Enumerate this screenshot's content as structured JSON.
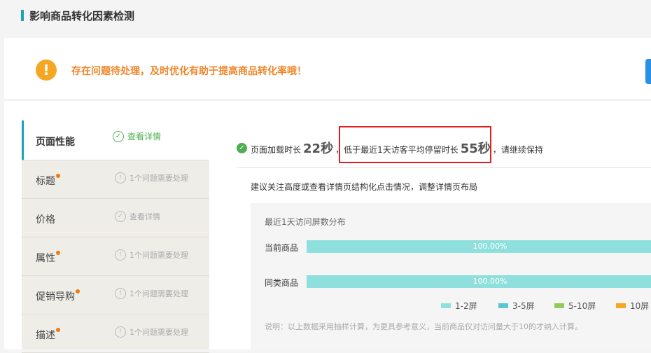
{
  "page": {
    "title": "影响商品转化因素检测"
  },
  "alert": {
    "text": "存在问题待处理，及时优化有助于提高商品转化率哦！",
    "icon": "warning-icon"
  },
  "sidebar": {
    "items": [
      {
        "label": "页面性能",
        "status": "查看详情",
        "has_issue": false,
        "active": true
      },
      {
        "label": "标题",
        "status": "1个问题需要处理",
        "has_issue": true
      },
      {
        "label": "价格",
        "status": "查看详情",
        "has_issue": false
      },
      {
        "label": "属性",
        "status": "1个问题需要处理",
        "has_issue": true
      },
      {
        "label": "促销导购",
        "status": "1个问题需要处理",
        "has_issue": true
      },
      {
        "label": "描述",
        "status": "1个问题需要处理",
        "has_issue": true
      }
    ]
  },
  "summary": {
    "prefix": "页面加载时长",
    "load_time": "22秒",
    "sep": "，",
    "middle": "低于最近1天访客平均停留时长",
    "stay_time": "55秒",
    "sep2": "，",
    "suffix": "请继续保持"
  },
  "advice": "建议关注高度或查看详情页结构化点击情况，调整详情页布局",
  "distribution": {
    "title": "最近1天访问屏数分布",
    "rows": [
      {
        "label": "当前商品",
        "value": "100.00%",
        "fraction": 1.0
      },
      {
        "label": "同类商品",
        "value": "100.00%",
        "fraction": 1.0
      }
    ],
    "legend": [
      {
        "label": "1-2屏",
        "color": "#8fe0dc"
      },
      {
        "label": "3-5屏",
        "color": "#5ac8d0"
      },
      {
        "label": "5-10屏",
        "color": "#8fcc5a"
      },
      {
        "label": "10屏",
        "color": "#f5a623"
      }
    ],
    "note": "说明：以上数据采用抽样计算，为更具参考意义，当前商品仅对访问量大于10的才纳入计算。"
  },
  "colors": {
    "accent": "#1aa3b8",
    "warning": "#f0862a",
    "success": "#4caf50",
    "highlight": "#e02020"
  }
}
